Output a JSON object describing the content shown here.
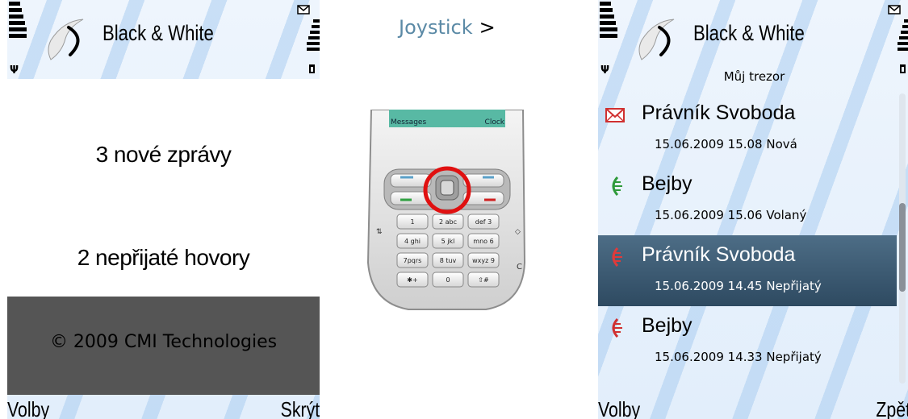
{
  "left_screen": {
    "app_title": "Black & White",
    "line_messages": "3 nové zprávy",
    "line_calls": "2 nepřijaté hovory",
    "copyright": "© 2009 CMI Technologies",
    "softkey_left": "Volby",
    "softkey_right": "Skrýt"
  },
  "middle": {
    "joystick_label": "Joystick",
    "arrow": ">",
    "phone_screen_left": "Messages",
    "phone_screen_right": "Clock",
    "keys": [
      "1",
      "2 abc",
      "def 3",
      "4 ghi",
      "5 jkl",
      "mno 6",
      "7pqrs",
      "8 tuv",
      "wxyz 9",
      "✱+",
      "0",
      "⇧#"
    ],
    "highlight_color": "#e01010"
  },
  "right_screen": {
    "app_title": "Black & White",
    "subtitle": "Můj trezor",
    "items": [
      {
        "name": "Právník Svoboda",
        "detail": "15.06.2009 15.08 Nová",
        "icon": "envelope-icon"
      },
      {
        "name": "Bejby",
        "detail": "15.06.2009 15.06 Volaný",
        "icon": "call-outgoing-icon"
      },
      {
        "name": "Právník Svoboda",
        "detail": "15.06.2009 14.45 Nepřijatý",
        "icon": "call-missed-icon"
      },
      {
        "name": "Bejby",
        "detail": "15.06.2009 14.33 Nepřijatý",
        "icon": "call-missed-icon"
      }
    ],
    "softkey_left": "Volby",
    "softkey_right": "Zpět"
  }
}
